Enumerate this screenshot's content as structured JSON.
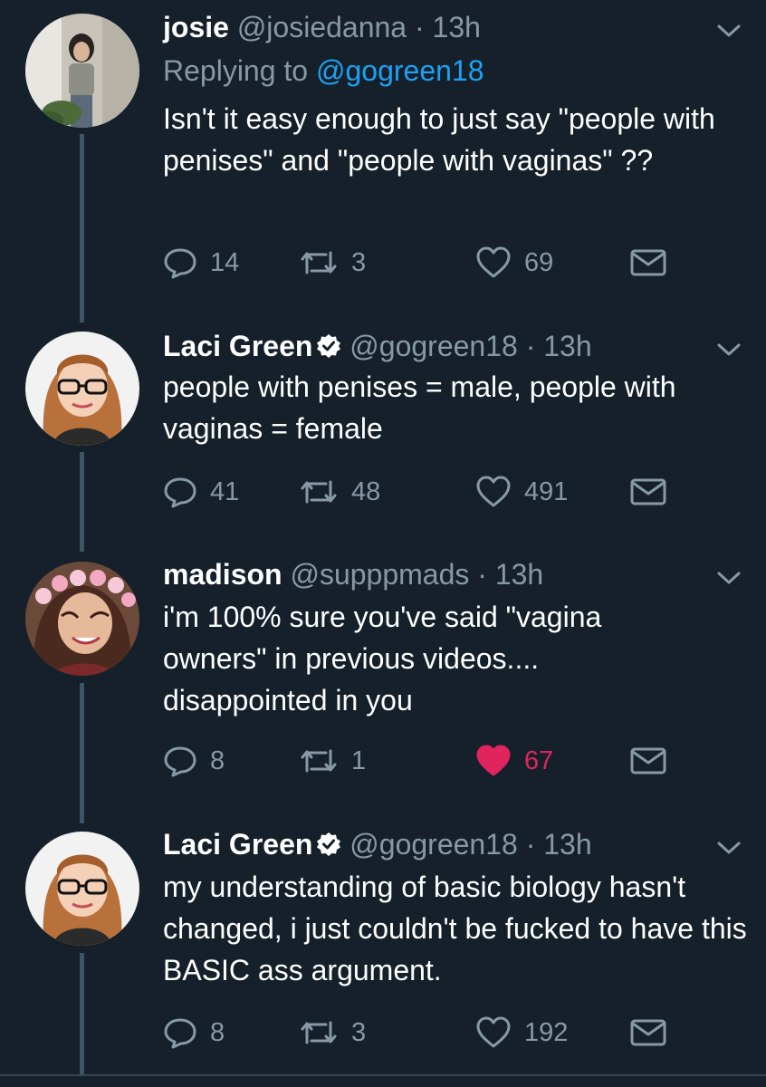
{
  "colors": {
    "background": "#15202b",
    "text": "#ffffff",
    "muted": "#8899a6",
    "link": "#1da1f2",
    "like_active": "#e0245e",
    "verified": "#ffffff"
  },
  "tweets": [
    {
      "name": "josie",
      "handle": "@josiedanna",
      "time": "· 13h",
      "reply_prefix": "Replying to",
      "reply_mention": "@gogreen18",
      "text": "Isn't it easy enough to just say \"people with penises\" and \"people with vaginas\" ??",
      "replies": "14",
      "retweets": "3",
      "likes": "69",
      "liked": false,
      "verified": false
    },
    {
      "name": "Laci Green",
      "handle": "@gogreen18",
      "time": "· 13h",
      "text": "people with penises = male, people with vaginas = female",
      "replies": "41",
      "retweets": "48",
      "likes": "491",
      "liked": false,
      "verified": true
    },
    {
      "name": "madison",
      "handle": "@supppmads",
      "time": "· 13h",
      "text": "i'm 100% sure you've said \"vagina owners\" in previous videos.... disappointed in you",
      "replies": "8",
      "retweets": "1",
      "likes": "67",
      "liked": true,
      "verified": false
    },
    {
      "name": "Laci Green",
      "handle": "@gogreen18",
      "time": "· 13h",
      "text": "my understanding of basic biology hasn't changed,  i just couldn't be fucked to have this BASIC ass argument.",
      "replies": "8",
      "retweets": "3",
      "likes": "192",
      "liked": false,
      "verified": true
    }
  ],
  "icons": {
    "reply": "reply-icon",
    "retweet": "retweet-icon",
    "like": "heart-icon",
    "dm": "envelope-icon",
    "menu": "chevron-down-icon",
    "verified": "verified-badge-icon"
  }
}
